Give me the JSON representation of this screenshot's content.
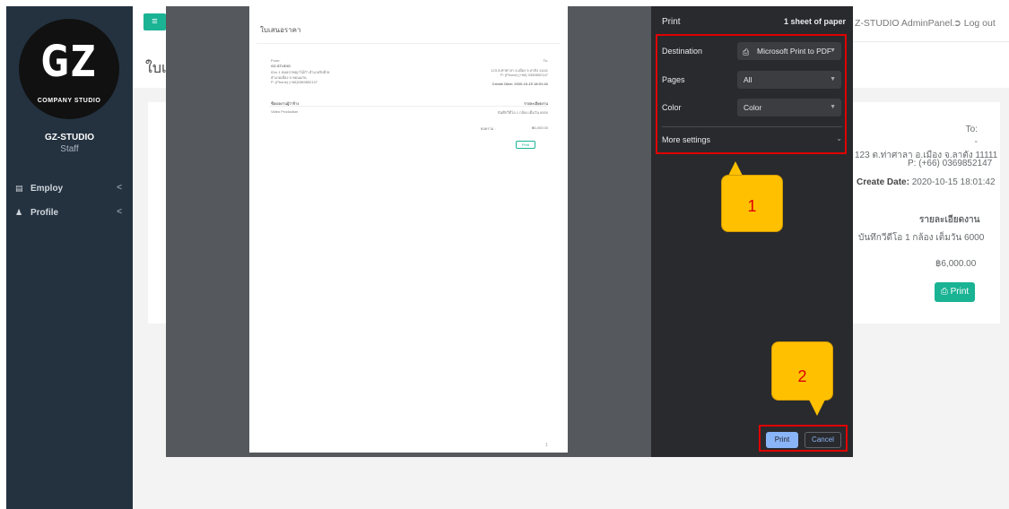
{
  "sidebar": {
    "logo_text": "GZ",
    "logo_subtext": "COMPANY STUDIO",
    "user_name": "GZ-STUDIO",
    "user_role": "Staff",
    "items": [
      {
        "icon": "list-icon",
        "label": "Employ",
        "chevron": "<"
      },
      {
        "icon": "user-icon",
        "label": "Profile",
        "chevron": "<"
      }
    ]
  },
  "topbar": {
    "menu_icon": "≡",
    "panel_text": "Z-STUDIO AdminPanel.",
    "logout_label": "Log out"
  },
  "page": {
    "heading_partial": "ใบเ"
  },
  "quote_card": {
    "to_label": "To:",
    "to_dash": "-",
    "address": "123 ต.ท่าศาลา อ.เมือง จ.ลาตัง 11111",
    "phone": "P: (+66) 0369852147",
    "create_date_label": "Create Date:",
    "create_date_value": "2020-10-15 18:01:42",
    "col_header": "รายละเอียดงาน",
    "description": "บันทึกวีดีโอ 1 กล้อง เต็มวัน 6000",
    "total": "฿6,000.00",
    "print_button": "Print"
  },
  "print_dialog": {
    "title": "Print",
    "sheets": "1 sheet of paper",
    "destination_label": "Destination",
    "destination_value": "Microsoft Print to PDF",
    "pages_label": "Pages",
    "pages_value": "All",
    "color_label": "Color",
    "color_value": "Color",
    "more_settings_label": "More settings",
    "print_button": "Print",
    "cancel_button": "Cancel"
  },
  "preview": {
    "doc_title": "ใบเสนอราคา",
    "from_label": "From:",
    "to_label": "To:",
    "company": "GZ-STUDIO",
    "line1": "ID/n 1 หมอกาพญาไม้กำ อำเภอรับฝ้าย",
    "line2": "อำเภอเมือง จ.ขอนแก่น",
    "line3": "P: (Phone) (+66)0369852147",
    "to_line1": "123 ต.ท่าศาลา อ.เมือง จ.ลาตัง 11111",
    "to_line2": "P: (Phone) (+66) 0369852147",
    "create_date": "Create Date: 2020-10-15 18:01:42",
    "col_left": "ชื่อ/ผลงานผู้ว่าจ้าง",
    "col_right": "รายละเอียดงาน",
    "row_left": "Video Production",
    "row_right": "บันทึกวีดีโอ 1 กล้อง เต็มวัน 6000",
    "total_label": "ยอดรวม :",
    "total_value": "฿6,000.00",
    "print_btn": "Print",
    "page_number": "1"
  },
  "annotations": {
    "callout_1": "1",
    "callout_2": "2"
  },
  "colors": {
    "sidebar_bg": "#243240",
    "accent_green": "#1ab394",
    "dialog_dark": "#292a2d",
    "annotation_red": "#e00000",
    "callout_yellow": "#ffc000",
    "print_blue": "#8ab4f8"
  }
}
